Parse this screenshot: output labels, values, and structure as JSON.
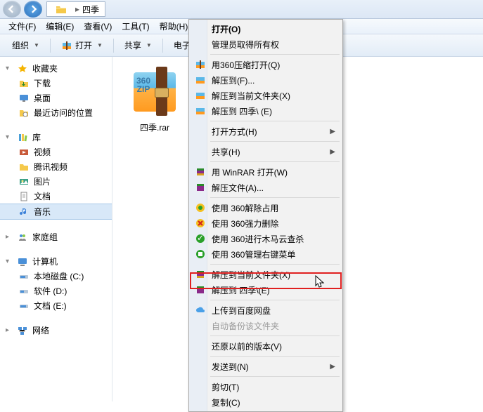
{
  "titlebar": {
    "breadcrumb": "四季"
  },
  "menubar": {
    "file": "文件(F)",
    "edit": "编辑(E)",
    "view": "查看(V)",
    "tools": "工具(T)",
    "help": "帮助(H)"
  },
  "toolbar": {
    "organize": "组织",
    "open": "打开",
    "share": "共享",
    "email": "电子"
  },
  "sidebar": {
    "favorites": {
      "label": "收藏夹",
      "items": [
        "下载",
        "桌面",
        "最近访问的位置"
      ]
    },
    "libraries": {
      "label": "库",
      "items": [
        "视频",
        "腾讯视频",
        "图片",
        "文档",
        "音乐"
      ]
    },
    "homegroup": {
      "label": "家庭组"
    },
    "computer": {
      "label": "计算机",
      "items": [
        "本地磁盘 (C:)",
        "软件 (D:)",
        "文档 (E:)"
      ]
    },
    "network": {
      "label": "网络"
    }
  },
  "file": {
    "name": "四季.rar",
    "badge1": "360",
    "badge2": "ZIP"
  },
  "context_menu": {
    "open": "打开(O)",
    "run_as_admin": "管理员取得所有权",
    "open_with_360zip": "用360压缩打开(Q)",
    "extract_to": "解压到(F)...",
    "extract_here_360": "解压到当前文件夹(X)",
    "extract_to_folder_360": "解压到 四季\\ (E)",
    "open_with": "打开方式(H)",
    "share": "共享(H)",
    "open_winrar": "用 WinRAR 打开(W)",
    "extract_files": "解压文件(A)...",
    "unlock_360": "使用 360解除占用",
    "force_delete_360": "使用 360强力删除",
    "trojan_scan_360": "使用 360进行木马云查杀",
    "manage_menu_360": "使用 360管理右键菜单",
    "extract_here_rar": "解压到当前文件夹(X)",
    "extract_to_folder_rar": "解压到 四季\\(E)",
    "upload_baidu": "上传到百度网盘",
    "auto_backup": "自动备份该文件夹",
    "restore": "还原以前的版本(V)",
    "send_to": "发送到(N)",
    "cut": "剪切(T)",
    "copy": "复制(C)"
  }
}
